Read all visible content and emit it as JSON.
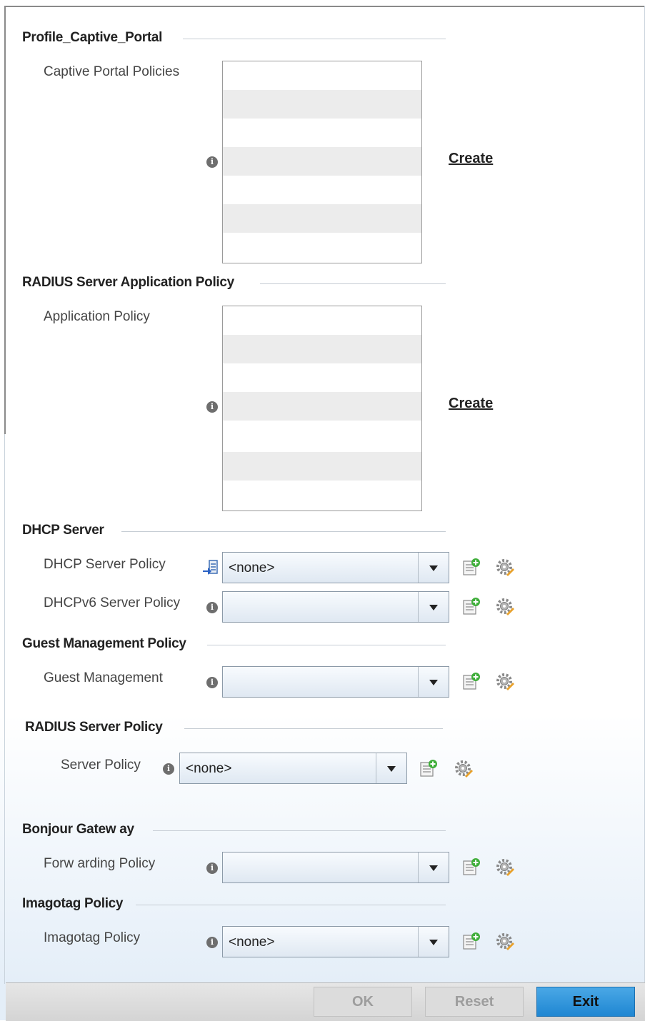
{
  "sections": {
    "captive_portal": {
      "title": "Profile_Captive_Portal",
      "field_label": "Captive Portal Policies",
      "create_label": "Create"
    },
    "radius_app": {
      "title": "RADIUS Server Application Policy",
      "field_label": "Application Policy",
      "create_label": "Create"
    },
    "dhcp": {
      "title": "DHCP Server",
      "server_policy_label": "DHCP Server Policy",
      "server_policy_value": "<none>",
      "v6_policy_label": "DHCPv6 Server Policy",
      "v6_policy_value": ""
    },
    "guest": {
      "title": "Guest Management Policy",
      "field_label": "Guest Management",
      "value": ""
    },
    "radius_server": {
      "title": "RADIUS Server Policy",
      "field_label": "Server Policy",
      "value": "<none>"
    },
    "bonjour": {
      "title": "Bonjour Gatew ay",
      "field_label": "Forw arding Policy",
      "value": ""
    },
    "imagotag": {
      "title": "Imagotag Policy",
      "field_label": "Imagotag Policy",
      "value": "<none>"
    }
  },
  "footer": {
    "ok_label": "OK",
    "reset_label": "Reset",
    "exit_label": "Exit"
  },
  "icons": {
    "info": "info-icon",
    "add": "add-policy-icon",
    "edit": "edit-settings-icon",
    "mapping": "mapping-icon"
  },
  "colors": {
    "primary_button": "#2a8fd8",
    "disabled_button": "#dcdcdc"
  }
}
